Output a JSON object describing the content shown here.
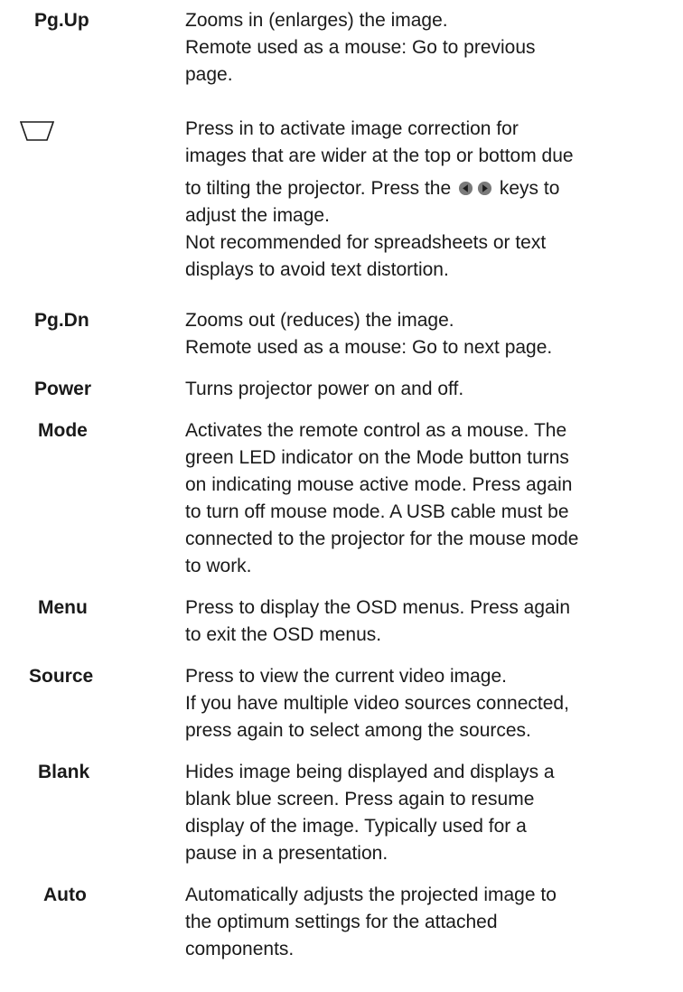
{
  "entries": [
    {
      "key": "pg_up",
      "term": "Pg.Up",
      "lines": [
        "Zooms in (enlarges) the image.",
        "Remote used as a mouse: Go to previous",
        "page."
      ]
    },
    {
      "key": "keystone",
      "term": "",
      "icon": "keystone-trapezoid-icon",
      "lines": [
        "Press in to activate image correction for",
        "images that are wider at the top or bottom due"
      ],
      "arrow_line": {
        "before": "to tilting the projector. Press the",
        "after": "keys to",
        "icons": [
          "left-arrow-circle-icon",
          "right-arrow-circle-icon"
        ]
      },
      "lines_after": [
        "adjust the image.",
        "Not recommended for spreadsheets or text",
        "displays to avoid text distortion."
      ]
    },
    {
      "key": "pg_dn",
      "term": "Pg.Dn",
      "lines": [
        "Zooms out (reduces) the image.",
        "Remote used as a mouse: Go to next page."
      ]
    },
    {
      "key": "power",
      "term": "Power",
      "lines": [
        "Turns projector power on and off."
      ]
    },
    {
      "key": "mode",
      "term": "Mode",
      "lines": [
        "Activates the remote control as a mouse. The",
        "green LED indicator on the Mode button turns",
        "on indicating mouse active mode. Press again",
        "to turn off mouse mode. A USB cable must be",
        "connected to the projector for the mouse mode",
        "to work."
      ]
    },
    {
      "key": "menu",
      "term": "Menu",
      "lines": [
        "Press to display the OSD menus. Press again",
        "to exit the OSD menus."
      ]
    },
    {
      "key": "source",
      "term": "Source",
      "lines": [
        "Press to view the current video image.",
        "If you have multiple video sources connected,",
        "press again to select among the sources."
      ]
    },
    {
      "key": "blank",
      "term": "Blank",
      "lines": [
        "Hides image being displayed and displays a",
        "blank blue screen. Press again to resume",
        "display of the image. Typically used for a",
        "pause in a presentation."
      ]
    },
    {
      "key": "auto",
      "term": "Auto",
      "lines": [
        "Automatically adjusts the projected image to",
        "the optimum settings for the attached",
        "components."
      ]
    }
  ],
  "colors": {
    "text": "#1a1a1a",
    "arrow_fill": "#7a7a7a"
  }
}
